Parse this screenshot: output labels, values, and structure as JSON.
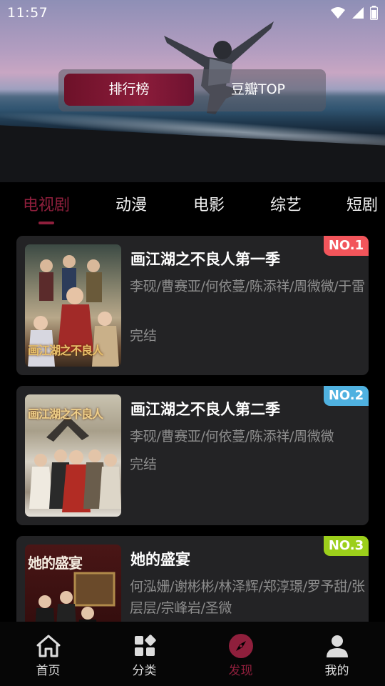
{
  "status_bar": {
    "time": "11:57"
  },
  "hero": {
    "toggle_active": "排行榜",
    "toggle_other": "豆瓣TOP"
  },
  "tabs": [
    {
      "label": "电视剧",
      "active": true
    },
    {
      "label": "动漫"
    },
    {
      "label": "电影"
    },
    {
      "label": "综艺"
    },
    {
      "label": "短剧"
    }
  ],
  "items": [
    {
      "rank": "NO.1",
      "rank_color": "#f2555b",
      "title": "画江湖之不良人第一季",
      "cast": "李砚/曹赛亚/何依蔓/陈添祥/周微微/于雷",
      "status": "完结",
      "poster_text": "画江湖之不良人"
    },
    {
      "rank": "NO.2",
      "rank_color": "#4fb1e0",
      "title": "画江湖之不良人第二季",
      "cast": "李砚/曹赛亚/何依蔓/陈添祥/周微微",
      "status": "完结",
      "poster_text": "画江湖之不良人"
    },
    {
      "rank": "NO.3",
      "rank_color": "#9ccf1b",
      "title": "她的盛宴",
      "cast": "何泓姗/谢彬彬/林泽辉/郑淳璟/罗予甜/张层层/宗峰岩/圣微",
      "poster_text": "她的盛宴"
    }
  ],
  "bottom_nav": [
    {
      "label": "首页",
      "icon": "home-icon"
    },
    {
      "label": "分类",
      "icon": "category-icon"
    },
    {
      "label": "发现",
      "icon": "compass-icon",
      "active": true
    },
    {
      "label": "我的",
      "icon": "profile-icon"
    }
  ],
  "colors": {
    "accent": "#8f1f3c",
    "card_bg": "#232325",
    "muted_text": "#8d8d8d"
  }
}
